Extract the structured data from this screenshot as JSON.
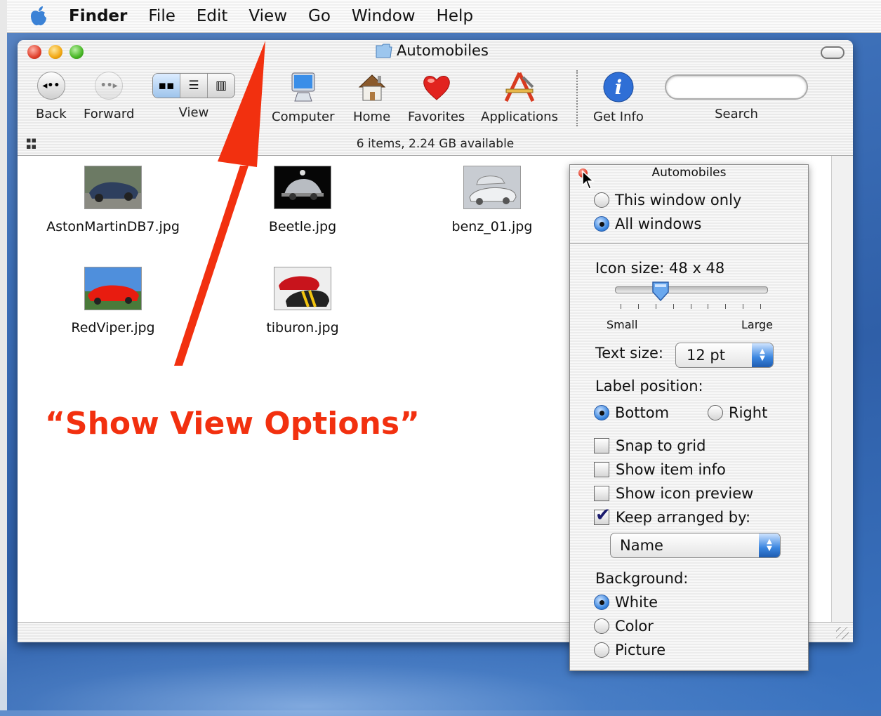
{
  "menubar": {
    "app_name": "Finder",
    "items": [
      "File",
      "Edit",
      "View",
      "Go",
      "Window",
      "Help"
    ]
  },
  "window": {
    "title": "Automobiles",
    "status": "6 items, 2.24 GB available"
  },
  "toolbar": {
    "back": "Back",
    "forward": "Forward",
    "view": "View",
    "computer": "Computer",
    "home": "Home",
    "favorites": "Favorites",
    "applications": "Applications",
    "get_info": "Get Info",
    "search": "Search"
  },
  "files": [
    {
      "name": "AstonMartinDB7.jpg",
      "icon": "image-thumbnail-aston-martin"
    },
    {
      "name": "Beetle.jpg",
      "icon": "image-thumbnail-beetle"
    },
    {
      "name": "benz_01.jpg",
      "icon": "image-thumbnail-benz"
    },
    {
      "name": "RedViper.jpg",
      "icon": "image-thumbnail-red-viper"
    },
    {
      "name": "tiburon.jpg",
      "icon": "image-thumbnail-tiburon"
    }
  ],
  "view_options": {
    "title": "Automobiles",
    "scope_this_window": "This window only",
    "scope_all_windows": "All windows",
    "scope_selected": "All windows",
    "icon_size_label": "Icon size: 48 x 48",
    "icon_size_level": 0.25,
    "small_label": "Small",
    "large_label": "Large",
    "text_size_label": "Text size:",
    "text_size_value": "12 pt",
    "label_position_label": "Label position:",
    "label_bottom": "Bottom",
    "label_right": "Right",
    "label_position_selected": "Bottom",
    "snap_to_grid": "Snap to grid",
    "show_item_info": "Show item info",
    "show_icon_preview": "Show icon preview",
    "keep_arranged_by": "Keep arranged by:",
    "keep_arranged_checked": true,
    "arrange_value": "Name",
    "background_label": "Background:",
    "bg_white": "White",
    "bg_color": "Color",
    "bg_picture": "Picture",
    "background_selected": "White"
  },
  "annotation": {
    "text": "“Show View Options”",
    "color": "#f2300f"
  },
  "colors": {
    "accent_blue": "#3a86e0",
    "close_red": "#e0402c",
    "minimize_yellow": "#f2a712",
    "zoom_green": "#47b625"
  }
}
